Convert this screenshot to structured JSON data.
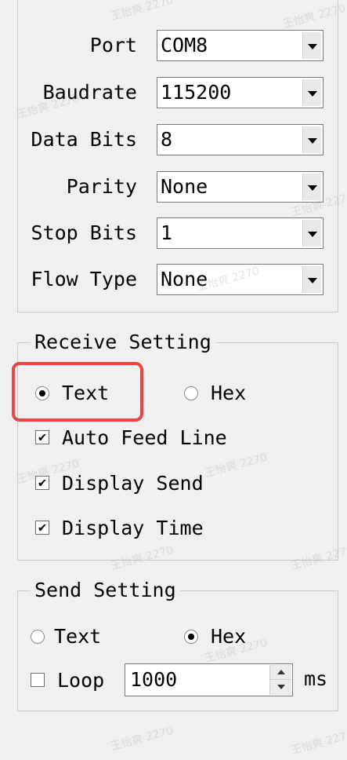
{
  "serial": {
    "fields": [
      {
        "label": "Port",
        "value": "COM8"
      },
      {
        "label": "Baudrate",
        "value": "115200"
      },
      {
        "label": "Data Bits",
        "value": "8"
      },
      {
        "label": "Parity",
        "value": "None"
      },
      {
        "label": "Stop Bits",
        "value": "1"
      },
      {
        "label": "Flow Type",
        "value": "None"
      }
    ]
  },
  "receive": {
    "title": "Receive Setting",
    "mode_text": "Text",
    "mode_hex": "Hex",
    "selected_mode": "Text",
    "auto_feed_line": "Auto Feed Line",
    "display_send": "Display Send",
    "display_time": "Display Time",
    "check_mark": "✔"
  },
  "send": {
    "title": "Send Setting",
    "mode_text": "Text",
    "mode_hex": "Hex",
    "selected_mode": "Hex",
    "loop_label": "Loop",
    "loop_value": "1000",
    "loop_unit": "ms"
  },
  "watermark": "王怡爽 2270",
  "colors": {
    "highlight": "#e8473f",
    "background": "#f0f0f0"
  }
}
